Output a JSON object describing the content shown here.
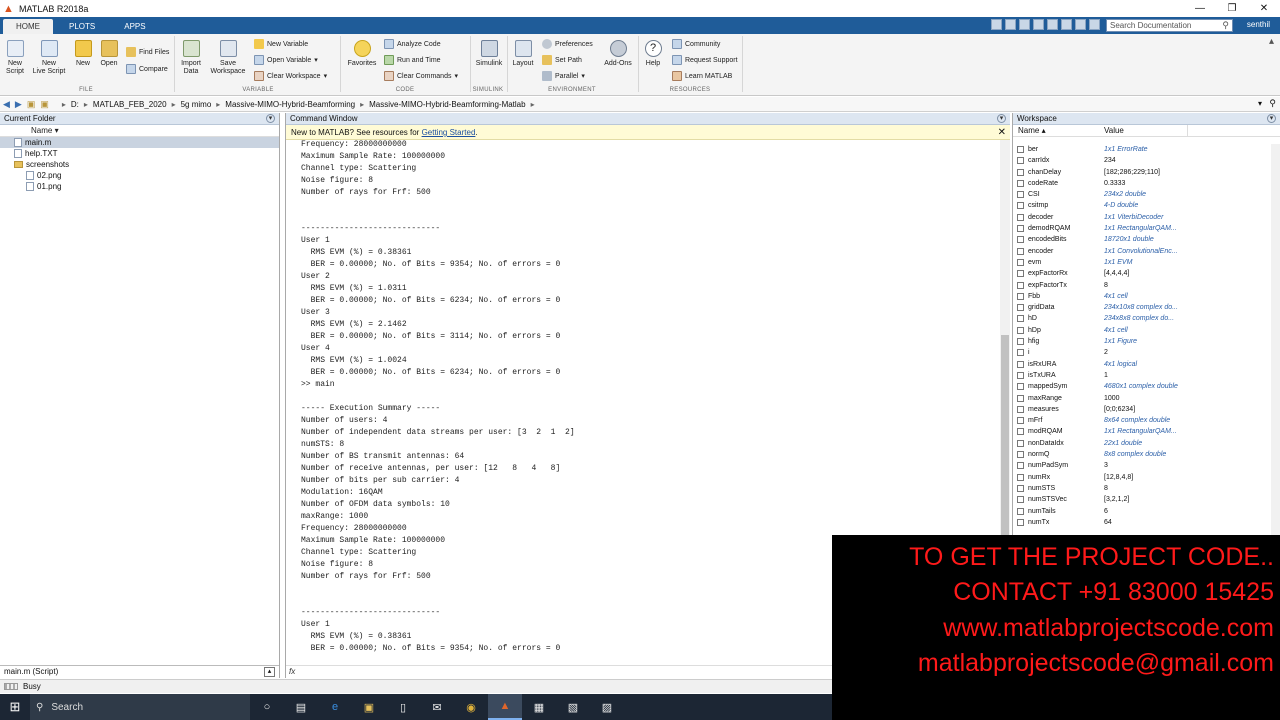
{
  "window": {
    "title": "MATLAB R2018a",
    "controls": [
      "—",
      "❐",
      "✕"
    ]
  },
  "tabs": [
    {
      "label": "HOME",
      "active": true
    },
    {
      "label": "PLOTS",
      "active": false
    },
    {
      "label": "APPS",
      "active": false
    }
  ],
  "search": {
    "placeholder": "Search Documentation"
  },
  "user": {
    "name": "senthil"
  },
  "ribbon": {
    "new_script": [
      "New",
      "Script"
    ],
    "new_live_script": [
      "New",
      "Live Script"
    ],
    "new": "New",
    "open": "Open",
    "find_files": "Find Files",
    "compare": "Compare",
    "import_data": [
      "Import",
      "Data"
    ],
    "save_workspace": [
      "Save",
      "Workspace"
    ],
    "new_variable": "New Variable",
    "open_variable": "Open Variable",
    "clear_workspace": "Clear Workspace",
    "favorites": "Favorites",
    "analyze_code": "Analyze Code",
    "run_and_time": "Run and Time",
    "clear_commands": "Clear Commands",
    "simulink": "Simulink",
    "layout": "Layout",
    "preferences": "Preferences",
    "set_path": "Set Path",
    "parallel": "Parallel",
    "add_ons": "Add-Ons",
    "help": "Help",
    "community": "Community",
    "request_support": "Request Support",
    "learn_matlab": "Learn MATLAB",
    "groups": [
      "FILE",
      "VARIABLE",
      "CODE",
      "SIMULINK",
      "ENVIRONMENT",
      "RESOURCES"
    ]
  },
  "address": {
    "segments": [
      "D:",
      "MATLAB_FEB_2020",
      "5g mimo",
      "Massive-MIMO-Hybrid-Beamforming",
      "Massive-MIMO-Hybrid-Beamforming-Matlab"
    ]
  },
  "current_folder": {
    "title": "Current Folder",
    "column": "Name ▾",
    "items": [
      {
        "name": "main.m",
        "type": "file",
        "indent": 0,
        "selected": true
      },
      {
        "name": "help.TXT",
        "type": "file",
        "indent": 0,
        "selected": false
      },
      {
        "name": "screenshots",
        "type": "folder",
        "indent": 0,
        "selected": false
      },
      {
        "name": "02.png",
        "type": "file",
        "indent": 1,
        "selected": false
      },
      {
        "name": "01.png",
        "type": "file",
        "indent": 1,
        "selected": false
      }
    ],
    "details": "main.m  (Script)"
  },
  "command_window": {
    "title": "Command Window",
    "notice_prefix": "New to MATLAB? See resources for ",
    "notice_link": "Getting Started",
    "notice_suffix": ".",
    "fx": "fx",
    "lines": [
      "Frequency: 28000000000",
      "Maximum Sample Rate: 100000000",
      "Channel type: Scattering",
      "Noise figure: 8",
      "Number of rays for Frf: 500",
      "",
      "",
      "-----------------------------",
      "User 1",
      "  RMS EVM (%) = 0.38361",
      "  BER = 0.00000; No. of Bits = 9354; No. of errors = 0",
      "User 2",
      "  RMS EVM (%) = 1.0311",
      "  BER = 0.00000; No. of Bits = 6234; No. of errors = 0",
      "User 3",
      "  RMS EVM (%) = 2.1462",
      "  BER = 0.00000; No. of Bits = 3114; No. of errors = 0",
      "User 4",
      "  RMS EVM (%) = 1.0024",
      "  BER = 0.00000; No. of Bits = 6234; No. of errors = 0",
      ">> main",
      "",
      "----- Execution Summary -----",
      "Number of users: 4",
      "Number of independent data streams per user: [3  2  1  2]",
      "numSTS: 8",
      "Number of BS transmit antennas: 64",
      "Number of receive antennas, per user: [12   8   4   8]",
      "Number of bits per sub carrier: 4",
      "Modulation: 16QAM",
      "Number of OFDM data symbols: 10",
      "maxRange: 1000",
      "Frequency: 28000000000",
      "Maximum Sample Rate: 100000000",
      "Channel type: Scattering",
      "Noise figure: 8",
      "Number of rays for Frf: 500",
      "",
      "",
      "-----------------------------",
      "User 1",
      "  RMS EVM (%) = 0.38361",
      "  BER = 0.00000; No. of Bits = 9354; No. of errors = 0"
    ]
  },
  "workspace": {
    "title": "Workspace",
    "col_name": "Name ▴",
    "col_value": "Value",
    "rows": [
      {
        "name": "ber",
        "value": "1x1 ErrorRate",
        "italic": true
      },
      {
        "name": "carrIdx",
        "value": "234",
        "italic": false
      },
      {
        "name": "chanDelay",
        "value": "[182;286;229;110]",
        "italic": false
      },
      {
        "name": "codeRate",
        "value": "0.3333",
        "italic": false
      },
      {
        "name": "CSI",
        "value": "234x2 double",
        "italic": true
      },
      {
        "name": "csitmp",
        "value": "4-D double",
        "italic": true
      },
      {
        "name": "decoder",
        "value": "1x1 ViterbiDecoder",
        "italic": true
      },
      {
        "name": "demodRQAM",
        "value": "1x1 RectangularQAM...",
        "italic": true
      },
      {
        "name": "encodedBits",
        "value": "18720x1 double",
        "italic": true
      },
      {
        "name": "encoder",
        "value": "1x1 ConvolutionalEnc...",
        "italic": true
      },
      {
        "name": "evm",
        "value": "1x1 EVM",
        "italic": true
      },
      {
        "name": "expFactorRx",
        "value": "[4,4,4,4]",
        "italic": false
      },
      {
        "name": "expFactorTx",
        "value": "8",
        "italic": false
      },
      {
        "name": "Fbb",
        "value": "4x1 cell",
        "italic": true
      },
      {
        "name": "gridData",
        "value": "234x10x8 complex do...",
        "italic": true
      },
      {
        "name": "hD",
        "value": "234x8x8 complex do...",
        "italic": true
      },
      {
        "name": "hDp",
        "value": "4x1 cell",
        "italic": true
      },
      {
        "name": "hfig",
        "value": "1x1 Figure",
        "italic": true
      },
      {
        "name": "i",
        "value": "2",
        "italic": false
      },
      {
        "name": "isRxURA",
        "value": "4x1 logical",
        "italic": true
      },
      {
        "name": "isTxURA",
        "value": "1",
        "italic": false
      },
      {
        "name": "mappedSym",
        "value": "4680x1 complex double",
        "italic": true
      },
      {
        "name": "maxRange",
        "value": "1000",
        "italic": false
      },
      {
        "name": "measures",
        "value": "[0;0;6234]",
        "italic": false
      },
      {
        "name": "mFrf",
        "value": "8x64 complex double",
        "italic": true
      },
      {
        "name": "modRQAM",
        "value": "1x1 RectangularQAM...",
        "italic": true
      },
      {
        "name": "nonDataIdx",
        "value": "22x1 double",
        "italic": true
      },
      {
        "name": "normQ",
        "value": "8x8 complex double",
        "italic": true
      },
      {
        "name": "numPadSym",
        "value": "3",
        "italic": false
      },
      {
        "name": "numRx",
        "value": "[12,8,4,8]",
        "italic": false
      },
      {
        "name": "numSTS",
        "value": "8",
        "italic": false
      },
      {
        "name": "numSTSVec",
        "value": "[3,2,1,2]",
        "italic": false
      },
      {
        "name": "numTails",
        "value": "6",
        "italic": false
      },
      {
        "name": "numTx",
        "value": "64",
        "italic": false
      }
    ]
  },
  "status": {
    "text": "Busy"
  },
  "taskbar": {
    "search_label": "Search"
  },
  "promo": {
    "line1": "TO GET THE PROJECT CODE..",
    "line2": "CONTACT +91 83000 15425",
    "line3": "www.matlabprojectscode.com",
    "line4": "matlabprojectscode@gmail.com"
  },
  "colors": {
    "accent": "#1f5c99",
    "promo_text": "#ff1a1a",
    "notice_bg": "#fffbd6"
  }
}
